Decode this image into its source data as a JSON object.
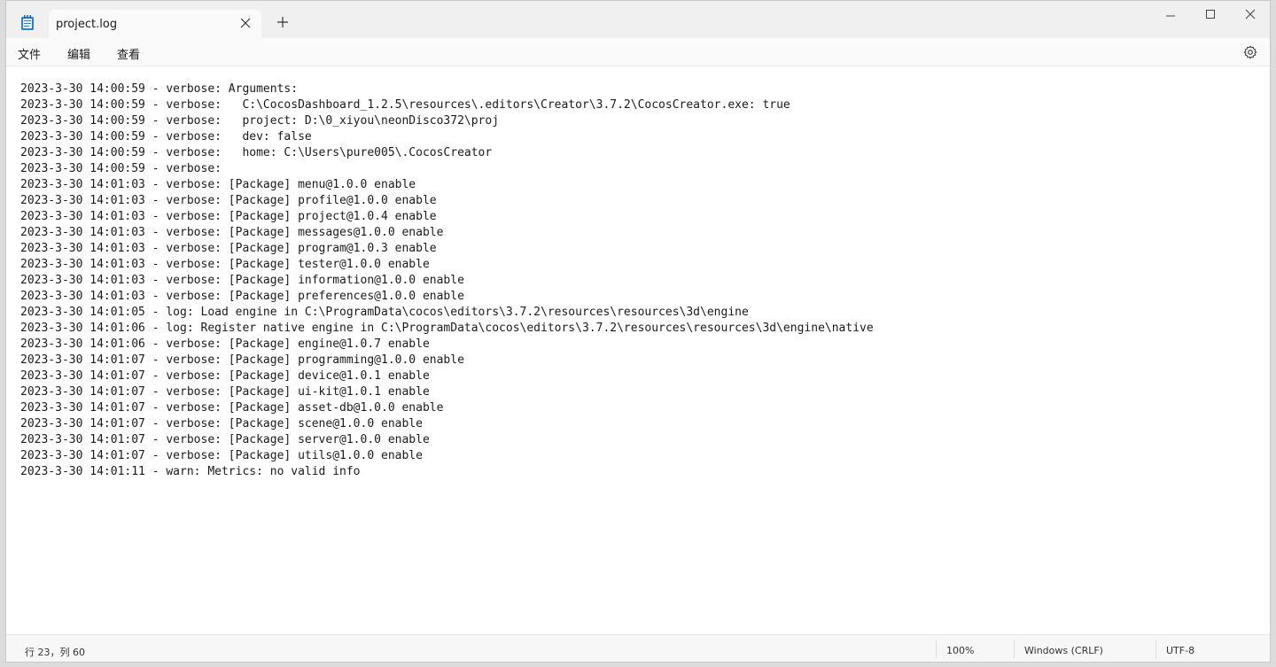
{
  "window": {
    "tab_title": "project.log",
    "controls": {
      "minimize_icon": "minimize-icon",
      "maximize_icon": "maximize-icon",
      "close_icon": "close-icon"
    }
  },
  "menu": {
    "file": "文件",
    "edit": "编辑",
    "view": "查看"
  },
  "editor": {
    "lines": [
      "2023-3-30 14:00:59 - verbose: Arguments:",
      "2023-3-30 14:00:59 - verbose:   C:\\CocosDashboard_1.2.5\\resources\\.editors\\Creator\\3.7.2\\CocosCreator.exe: true",
      "2023-3-30 14:00:59 - verbose:   project: D:\\0_xiyou\\neonDisco372\\proj",
      "2023-3-30 14:00:59 - verbose:   dev: false",
      "2023-3-30 14:00:59 - verbose:   home: C:\\Users\\pure005\\.CocosCreator",
      "2023-3-30 14:00:59 - verbose:",
      "2023-3-30 14:01:03 - verbose: [Package] menu@1.0.0 enable",
      "2023-3-30 14:01:03 - verbose: [Package] profile@1.0.0 enable",
      "2023-3-30 14:01:03 - verbose: [Package] project@1.0.4 enable",
      "2023-3-30 14:01:03 - verbose: [Package] messages@1.0.0 enable",
      "2023-3-30 14:01:03 - verbose: [Package] program@1.0.3 enable",
      "2023-3-30 14:01:03 - verbose: [Package] tester@1.0.0 enable",
      "2023-3-30 14:01:03 - verbose: [Package] information@1.0.0 enable",
      "2023-3-30 14:01:03 - verbose: [Package] preferences@1.0.0 enable",
      "2023-3-30 14:01:05 - log: Load engine in C:\\ProgramData\\cocos\\editors\\3.7.2\\resources\\resources\\3d\\engine",
      "2023-3-30 14:01:06 - log: Register native engine in C:\\ProgramData\\cocos\\editors\\3.7.2\\resources\\resources\\3d\\engine\\native",
      "2023-3-30 14:01:06 - verbose: [Package] engine@1.0.7 enable",
      "2023-3-30 14:01:07 - verbose: [Package] programming@1.0.0 enable",
      "2023-3-30 14:01:07 - verbose: [Package] device@1.0.1 enable",
      "2023-3-30 14:01:07 - verbose: [Package] ui-kit@1.0.1 enable",
      "2023-3-30 14:01:07 - verbose: [Package] asset-db@1.0.0 enable",
      "2023-3-30 14:01:07 - verbose: [Package] scene@1.0.0 enable",
      "2023-3-30 14:01:07 - verbose: [Package] server@1.0.0 enable",
      "2023-3-30 14:01:07 - verbose: [Package] utils@1.0.0 enable",
      "2023-3-30 14:01:11 - warn: Metrics: no valid info"
    ]
  },
  "status": {
    "position": "行 23，列 60",
    "zoom": "100%",
    "line_ending": "Windows (CRLF)",
    "encoding": "UTF-8"
  },
  "colors": {
    "accent": "#1a1a1a",
    "titlebar": "#f0f0f0",
    "notepad_icon_blue": "#2b7fd6"
  }
}
